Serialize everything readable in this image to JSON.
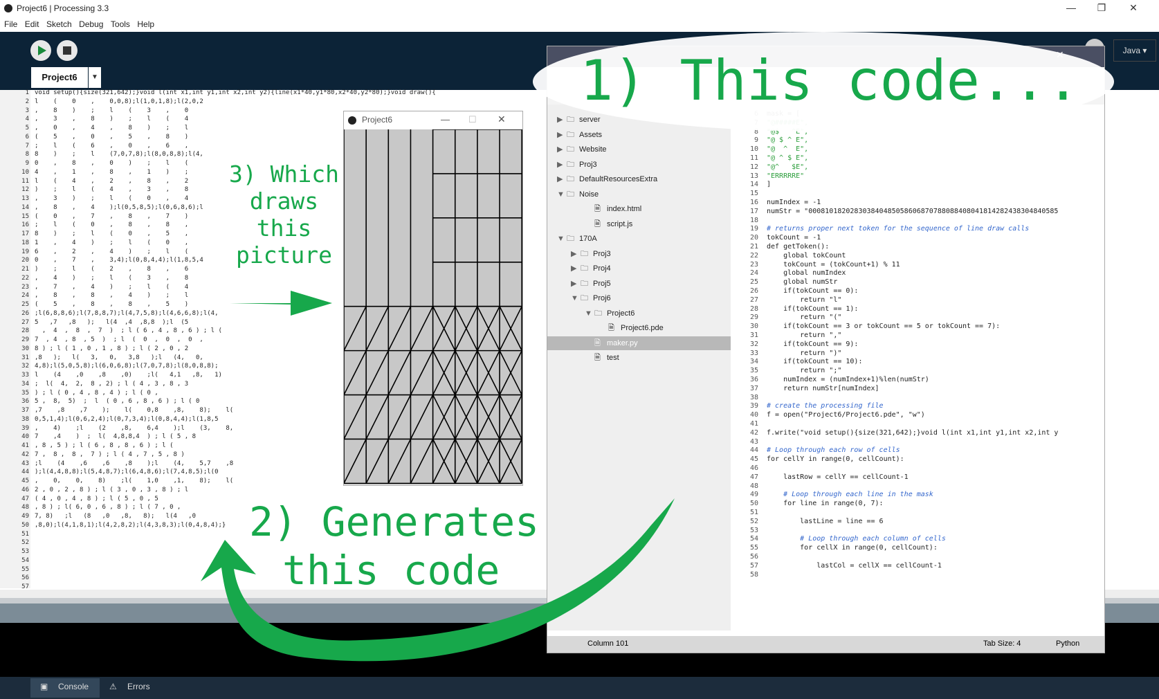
{
  "window": {
    "title": "Project6 | Processing 3.3"
  },
  "menu": [
    "File",
    "Edit",
    "Sketch",
    "Debug",
    "Tools",
    "Help"
  ],
  "tab": {
    "label": "Project6"
  },
  "mode": {
    "label": "Java ▾"
  },
  "editor": {
    "line_numbers": [
      "1",
      "2",
      "3",
      "4",
      "5",
      "6",
      "7",
      "8",
      "9",
      "10",
      "11",
      "12",
      "13",
      "14",
      "15",
      "16",
      "17",
      "18",
      "19",
      "20",
      "21",
      "22",
      "23",
      "24",
      "25",
      "26",
      "27",
      "28",
      "29",
      "30",
      "31",
      "32",
      "33",
      "34",
      "35",
      "36",
      "37",
      "38",
      "39",
      "40",
      "41",
      "42",
      "43",
      "44",
      "45",
      "46",
      "47",
      "48",
      "49",
      "50",
      "51",
      "52",
      "53",
      "54",
      "55",
      "56",
      "57"
    ],
    "lines": [
      "void setup(){size(321,642);}void l(int x1,int y1,int x2,int y2){line(x1*40,y1*80,x2*40,y2*80);}void draw(){",
      "l    (    0    ,    0,0,8);l(1,0,1,8);l(2,0,2",
      ",    8    )    ;    l    (    3    ,    0",
      ",    3    ,    8    )    ;    l    (    4",
      ",    0    ,    4    ,    8    )    ;    l",
      "(    5    ,    0    ,    5    ,    8    )",
      ";    l    (    6    ,    0    ,    6    ,",
      "8    )    ;    l    (7,0,7,8);l(8,0,8,8);l(4,",
      "0    ,    8    ,    0    )    ;    l    (",
      "4    ,    1    ,    8    ,    1    )    ;",
      "l    (    4    ,    2    ,    8    ,    2",
      ")    ;    l    (    4    ,    3    ,    8",
      ",    3    )    ;    l    (    0    ,    4",
      ",    8    ,    4    );l(0,5,8,5);l(0,6,8,6);l",
      "(    0    ,    7    ,    8    ,    7    )",
      ";    l    (    0    ,    8    ,    8    ,",
      "8    )    ;    l    (    0    ,    5    ,",
      "1    ,    4    )    ;    l    (    0    ,",
      "6    ,    2    ,    4    )    ;    l    (",
      "0    ,    7    ,    3,4);l(0,8,4,4);l(1,8,5,4",
      ")    ;    l    (    2    ,    8    ,    6",
      ",    4    )    ;    l    (    3    ,    8",
      ",    7    ,    4    )    ;    l    (    4",
      ",    8    ,    8    ,    4    )    ;    l",
      "(    5    ,    8    ,    8    ,    5    )",
      ";l(6,8,8,6);l(7,8,8,7);l(4,7,5,8);l(4,6,6,8);l(4,",
      "5   ,7   ,8   );   l(4  ,4  ,8,8  );l  (5",
      "  ,  4  ,  8  ,  7  )  ; l ( 6 , 4 , 8 , 6 ) ; l (",
      "7  , 4  , 8  , 5  )  ; l  (  0  ,  0  ,  0  ,",
      "8 ) ; l ( 1 , 0 , 1 , 8 ) ; l ( 2 , 0 , 2",
      ",8   );   l(   3,   0,   3,8   );l   (4,   0,",
      "4,8);l(5,0,5,8);l(6,0,6,8);l(7,0,7,8);l(8,0,8,8);",
      "l    (4    ,0    ,8    ,0)    ;l(   4,1   ,8,   1)",
      ";  l(  4,  2,  8 , 2) ; l ( 4 , 3 , 8 , 3",
      ") ; l ( 0 , 4 , 8 , 4 ) ; l ( 0 ,",
      "5 ,  8,  5)  ;  l  ( 0 , 6 , 8 , 6 ) ; l ( 0",
      ",7    ,8    ,7    );    l(    0,8    ,8,    8);    l(",
      "0,5,1,4);l(0,6,2,4);l(0,7,3,4);l(0,8,4,4);l(1,8,5",
      ",    4)    ;l    (2    ,8,    6,4    );l    (3,    8,",
      "7    ,4    )  ;  l(  4,8,8,4  ) ; l ( 5 , 8",
      ", 8 , 5 ) ; l ( 6 , 8 , 8 , 6 ) ; l (",
      "7 ,  8 ,  8 ,  7 ) ; l ( 4 , 7 , 5 , 8 )",
      ";l    (4    ,6    ,6    ,8    );l    (4,    5,7    ,8",
      ");l(4,4,8,8);l(5,4,8,7);l(6,4,8,6);l(7,4,8,5);l(0",
      ",    0,    0,    8)    ;l(    1,0    ,1,    8);    l(",
      "2 , 0 , 2 , 8 ) ; l ( 3 , 0 , 3 , 8 ) ; l",
      "( 4 , 0 , 4 , 8 ) ; l ( 5 , 0 , 5",
      ", 8 ) ; l( 6, 0 , 6 , 8 ) ; l ( 7 , 0 ,",
      "7, 8)   ;l   (8   ,0   ,8,   8);   l(4   ,0",
      ",8,0);l(4,1,8,1);l(4,2,8,2);l(4,3,8,3);l(0,4,8,4);}",
      "",
      "",
      "",
      "",
      "",
      "",
      ""
    ]
  },
  "console_tabs": {
    "console": "Console",
    "errors": "Errors"
  },
  "sketch": {
    "title": "Project6"
  },
  "code_window": {
    "tree": [
      {
        "label": "server",
        "type": "folder",
        "open": false
      },
      {
        "label": "Assets",
        "type": "folder",
        "open": false
      },
      {
        "label": "Website",
        "type": "folder",
        "open": false
      },
      {
        "label": "Proj3",
        "type": "folder",
        "open": false
      },
      {
        "label": "DefaultResourcesExtra",
        "type": "folder",
        "open": false
      },
      {
        "label": "Noise",
        "type": "folder",
        "open": true
      },
      {
        "label": "index.html",
        "type": "file"
      },
      {
        "label": "script.js",
        "type": "file"
      },
      {
        "label": "170A",
        "type": "folder",
        "open": true
      },
      {
        "label": "Proj3",
        "type": "folder",
        "open": false
      },
      {
        "label": "Proj4",
        "type": "folder",
        "open": false
      },
      {
        "label": "Proj5",
        "type": "folder",
        "open": false
      },
      {
        "label": "Proj6",
        "type": "folder",
        "open": true
      },
      {
        "label": "Project6",
        "type": "folder",
        "open": true
      },
      {
        "label": "Project6.pde",
        "type": "file"
      },
      {
        "label": "maker.py",
        "type": "file",
        "selected": true
      },
      {
        "label": "test",
        "type": "file"
      }
    ],
    "line_numbers": [
      "6",
      "7",
      "8",
      "9",
      "10",
      "11",
      "12",
      "13",
      "14",
      "15",
      "16",
      "17",
      "18",
      "19",
      "20",
      "21",
      "22",
      "23",
      "24",
      "25",
      "26",
      "27",
      "28",
      "29",
      "30",
      "31",
      "32",
      "33",
      "34",
      "35",
      "36",
      "37",
      "38",
      "39",
      "40",
      "41",
      "42",
      "43",
      "44",
      "45",
      "46",
      "47",
      "48",
      "49",
      "50",
      "51",
      "52",
      "53",
      "54",
      "55",
      "56",
      "57",
      "58"
    ],
    "code": [
      "mask = [",
      "\"@#####E\",",
      "\"@$   ^E\",",
      "\"@ $ ^ E\",",
      "\"@  ^  E\",",
      "\"@ ^ $ E\",",
      "\"@^   $E\",",
      "\"ERRRRRE\"",
      "]",
      "",
      "numIndex = -1",
      "numStr = \"000810182028303840485058606870788088408041814282438304840585",
      "",
      "# returns proper next token for the sequence of line draw calls",
      "tokCount = -1",
      "def getToken():",
      "    global tokCount",
      "    tokCount = (tokCount+1) % 11",
      "    global numIndex",
      "    global numStr",
      "    if(tokCount == 0):",
      "        return \"l\"",
      "    if(tokCount == 1):",
      "        return \"(\"",
      "    if(tokCount == 3 or tokCount == 5 or tokCount == 7):",
      "        return \",\"",
      "    if(tokCount == 9):",
      "        return \")\"",
      "    if(tokCount == 10):",
      "        return \";\"",
      "    numIndex = (numIndex+1)%len(numStr)",
      "    return numStr[numIndex]",
      "",
      "# create the processing file",
      "f = open(\"Project6/Project6.pde\", \"w\")",
      "",
      "f.write(\"void setup(){size(321,642);}void l(int x1,int y1,int x2,int y",
      "",
      "# Loop through each row of cells",
      "for cellY in range(0, cellCount):",
      "",
      "    lastRow = cellY == cellCount-1",
      "",
      "    # Loop through each line in the mask",
      "    for line in range(0, 7):",
      "",
      "        lastLine = line == 6",
      "",
      "        # Loop through each column of cells",
      "        for cellX in range(0, cellCount):",
      "",
      "            lastCol = cellX == cellCount-1",
      ""
    ],
    "status": {
      "position": "Column 101",
      "tab_size": "Tab Size: 4",
      "language": "Python"
    }
  },
  "annotations": {
    "a1": "1) This code...",
    "a2_line1": "2) Generates",
    "a2_line2": "this code",
    "a3_line1": "3) Which",
    "a3_line2": "draws",
    "a3_line3": "this",
    "a3_line4": "picture"
  },
  "colors": {
    "toolbar": "#0c2337",
    "annotation": "#17a84b",
    "comment": "#3366cc",
    "string": "#2a9d3a"
  }
}
